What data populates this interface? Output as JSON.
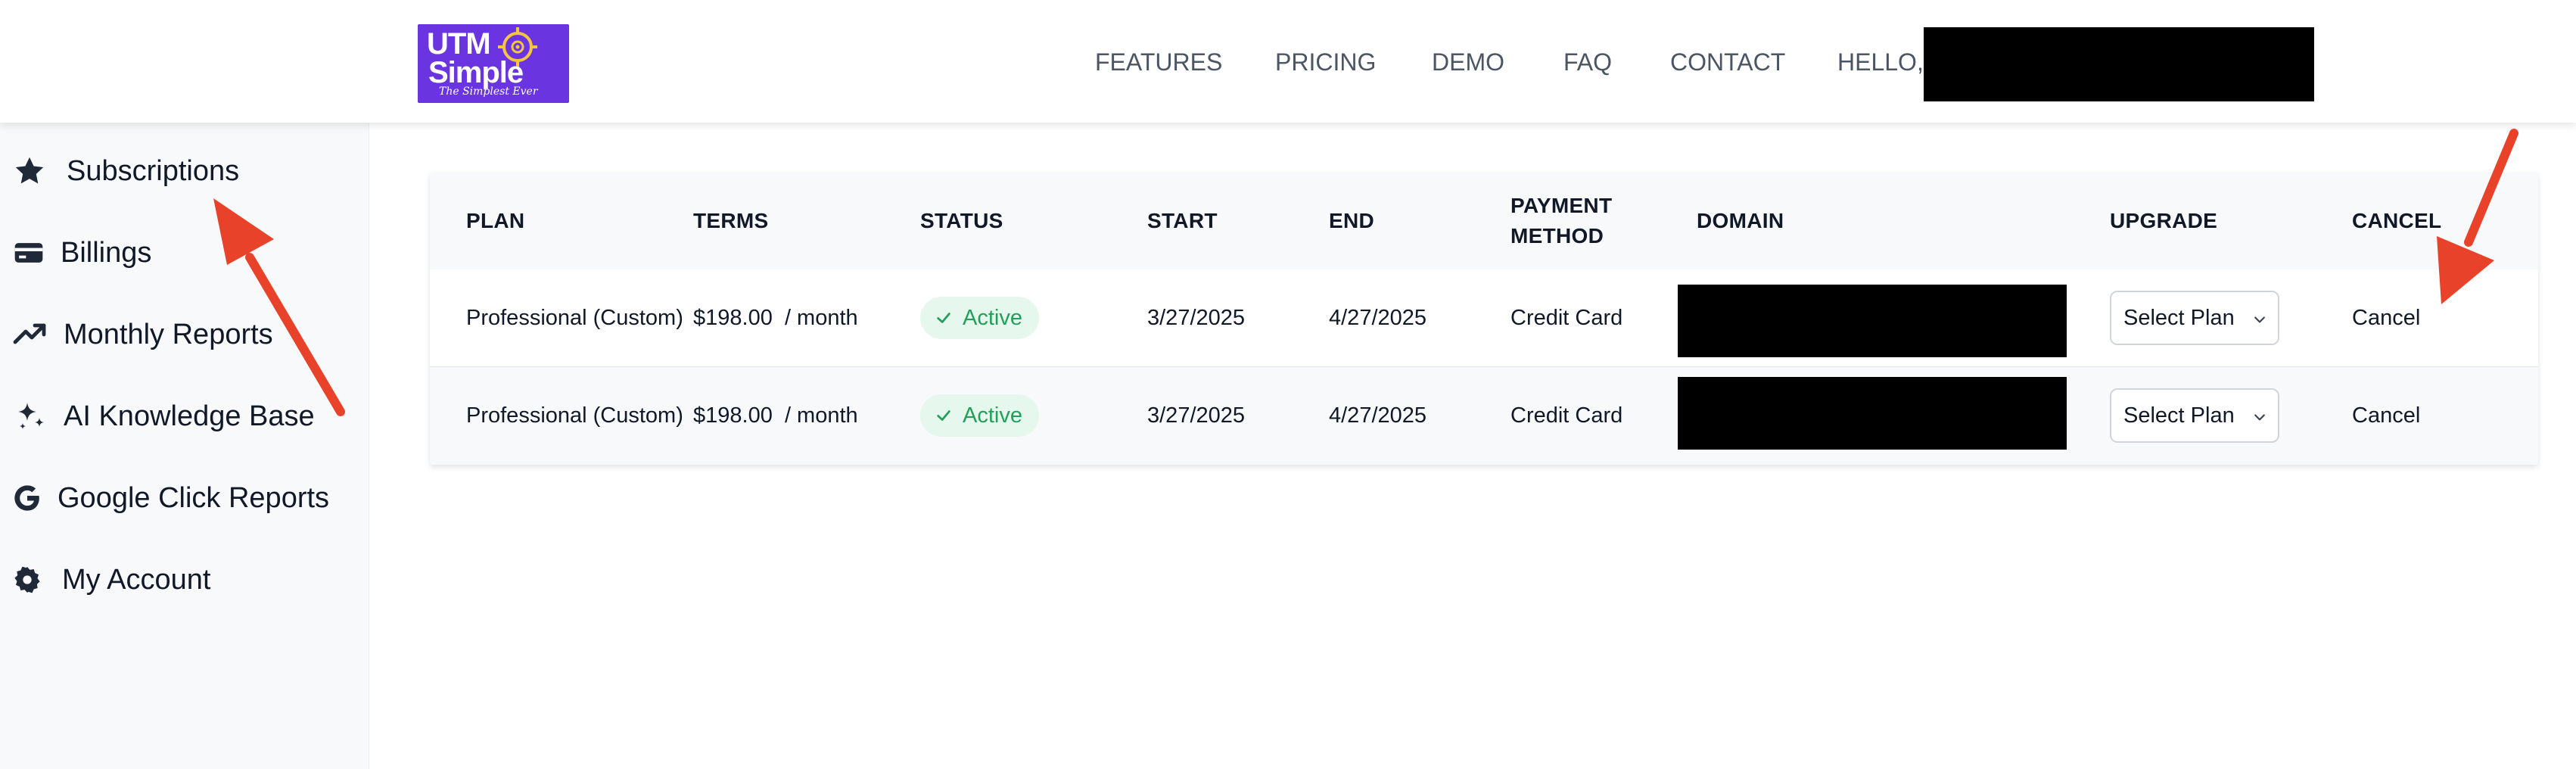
{
  "header": {
    "logo": {
      "line1": "UTM",
      "line2": "Simple",
      "tagline": "The Simplest Ever"
    },
    "nav": [
      {
        "label": "FEATURES"
      },
      {
        "label": "PRICING"
      },
      {
        "label": "DEMO"
      },
      {
        "label": "FAQ"
      },
      {
        "label": "CONTACT"
      }
    ],
    "greeting": "HELLO,"
  },
  "sidebar": {
    "items": [
      {
        "label": "Subscriptions",
        "icon": "star-icon"
      },
      {
        "label": "Billings",
        "icon": "credit-card-icon"
      },
      {
        "label": "Monthly Reports",
        "icon": "trending-up-icon"
      },
      {
        "label": "AI Knowledge Base",
        "icon": "sparkles-icon"
      },
      {
        "label": "Google Click Reports",
        "icon": "google-icon"
      },
      {
        "label": "My Account",
        "icon": "gear-icon"
      }
    ]
  },
  "table": {
    "headers": {
      "plan": "PLAN",
      "terms": "TERMS",
      "status": "STATUS",
      "start": "START",
      "end": "END",
      "payment_line1": "PAYMENT",
      "payment_line2": "METHOD",
      "domain": "DOMAIN",
      "upgrade": "UPGRADE",
      "cancel": "CANCEL"
    },
    "rows": [
      {
        "plan": "Professional (Custom)",
        "terms": "$198.00  / month",
        "status": "Active",
        "start": "3/27/2025",
        "end": "4/27/2025",
        "payment": "Credit Card",
        "upgrade": "Select Plan",
        "cancel": "Cancel"
      },
      {
        "plan": "Professional (Custom)",
        "terms": "$198.00  / month",
        "status": "Active",
        "start": "3/27/2025",
        "end": "4/27/2025",
        "payment": "Credit Card",
        "upgrade": "Select Plan",
        "cancel": "Cancel"
      }
    ]
  },
  "colors": {
    "brand": "#6a35e0",
    "status_active_bg": "#e6f7ee",
    "status_active_text": "#22a05a",
    "annotation_arrow": "#e8432a"
  }
}
